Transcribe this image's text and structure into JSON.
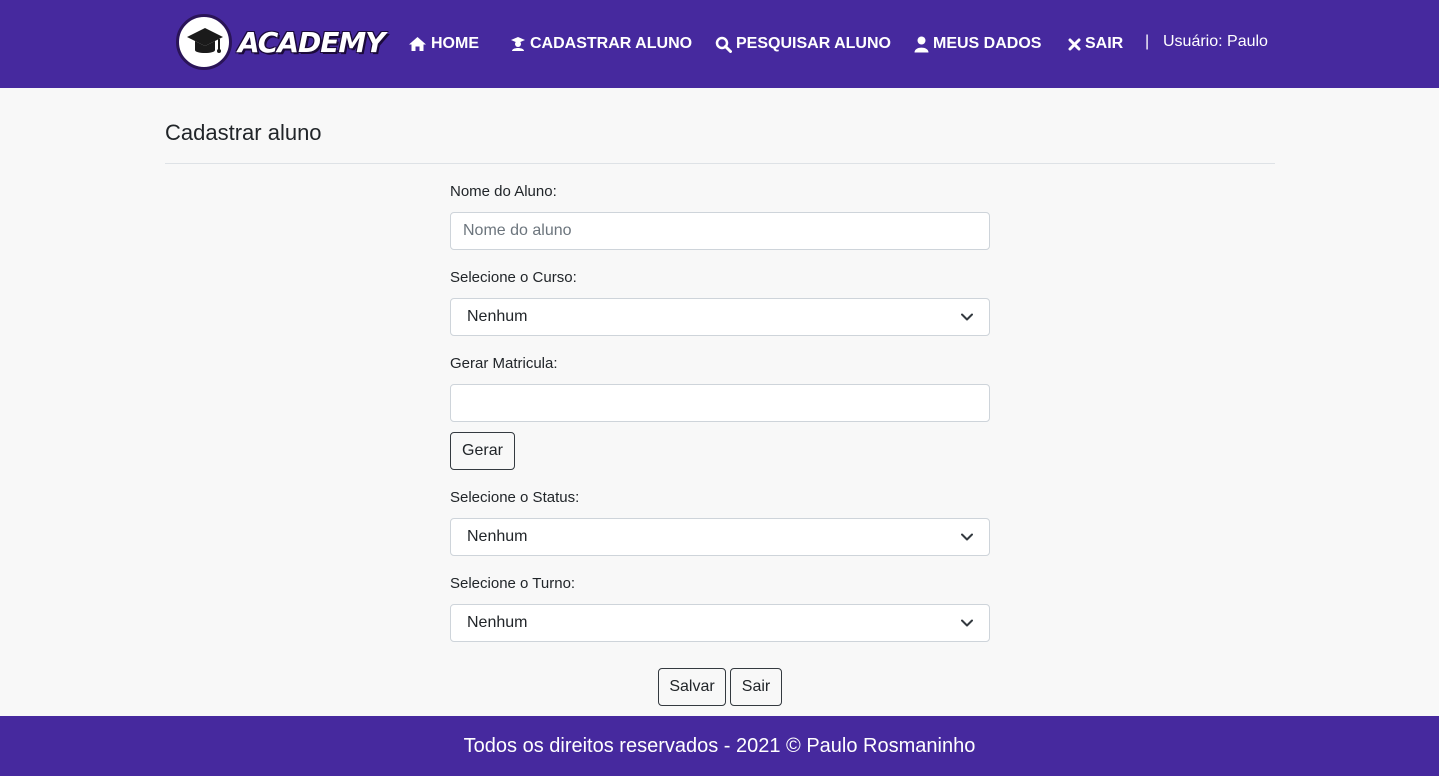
{
  "brand": {
    "name": "ACADEMY",
    "logo_icon": "graduation-cap-icon"
  },
  "nav": {
    "items": [
      {
        "label": "HOME",
        "icon": "home-icon"
      },
      {
        "label": "CADASTRAR ALUNO",
        "icon": "student-icon"
      },
      {
        "label": "PESQUISAR ALUNO",
        "icon": "search-icon"
      },
      {
        "label": "MEUS DADOS",
        "icon": "user-icon"
      },
      {
        "label": "SAIR",
        "icon": "close-icon"
      }
    ],
    "separator": "|",
    "user_text": "Usuário: Paulo"
  },
  "page": {
    "title": "Cadastrar aluno"
  },
  "form": {
    "nome_label": "Nome do Aluno:",
    "nome_placeholder": "Nome do aluno",
    "nome_value": "",
    "curso_label": "Selecione o Curso:",
    "curso_value": "Nenhum",
    "matricula_label": "Gerar Matricula:",
    "matricula_value": "",
    "gerar_label": "Gerar",
    "status_label": "Selecione o Status:",
    "status_value": "Nenhum",
    "turno_label": "Selecione o Turno:",
    "turno_value": "Nenhum",
    "salvar_label": "Salvar",
    "sair_label": "Sair"
  },
  "footer": {
    "text": "Todos os direitos reservados - 2021 © Paulo Rosmaninho"
  },
  "colors": {
    "primary": "#46299e",
    "background": "#f8f8f8",
    "border": "#ced4da",
    "text": "#212529"
  }
}
